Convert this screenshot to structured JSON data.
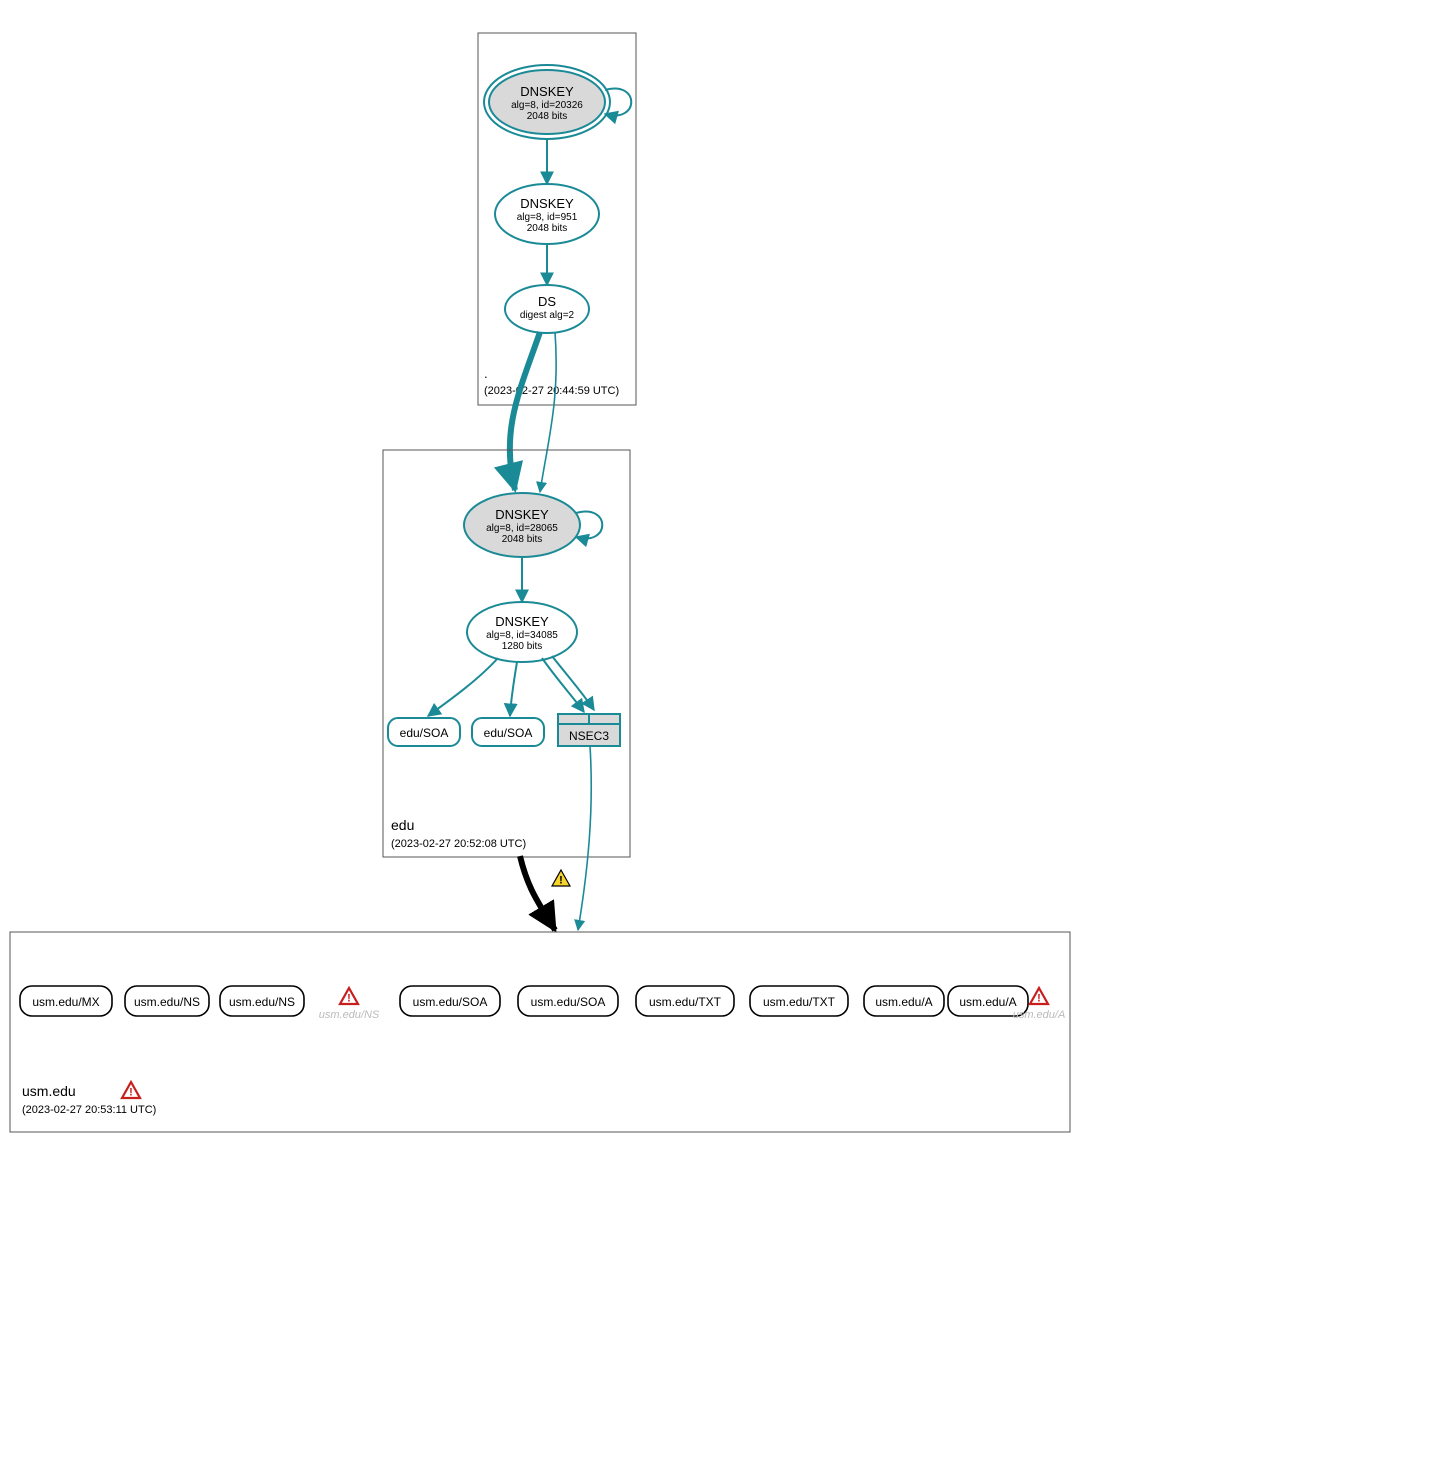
{
  "zones": {
    "root": {
      "label": ".",
      "timestamp": "(2023-02-27 20:44:59 UTC)",
      "dnskey_ksk": {
        "title": "DNSKEY",
        "sub1": "alg=8, id=20326",
        "sub2": "2048 bits"
      },
      "dnskey_zsk": {
        "title": "DNSKEY",
        "sub1": "alg=8, id=951",
        "sub2": "2048 bits"
      },
      "ds": {
        "title": "DS",
        "sub1": "digest alg=2"
      }
    },
    "edu": {
      "label": "edu",
      "timestamp": "(2023-02-27 20:52:08 UTC)",
      "dnskey_ksk": {
        "title": "DNSKEY",
        "sub1": "alg=8, id=28065",
        "sub2": "2048 bits"
      },
      "dnskey_zsk": {
        "title": "DNSKEY",
        "sub1": "alg=8, id=34085",
        "sub2": "1280 bits"
      },
      "rrsets": {
        "soa1": "edu/SOA",
        "soa2": "edu/SOA",
        "nsec3": "NSEC3"
      }
    },
    "usm": {
      "label": "usm.edu",
      "timestamp": "(2023-02-27 20:53:11 UTC)",
      "rrsets": [
        "usm.edu/MX",
        "usm.edu/NS",
        "usm.edu/NS",
        "usm.edu/SOA",
        "usm.edu/SOA",
        "usm.edu/TXT",
        "usm.edu/TXT",
        "usm.edu/A",
        "usm.edu/A"
      ],
      "error_labels": {
        "ns": "usm.edu/NS",
        "a": "usm.edu/A"
      }
    }
  },
  "colors": {
    "teal": "#1b8a97",
    "black": "#000000",
    "grayFill": "#d9d9d9",
    "lightFill": "#ffffff",
    "boxStroke": "#555",
    "faded": "#bbbbbb",
    "red": "#c81e1e",
    "yellow": "#f6d42a"
  }
}
